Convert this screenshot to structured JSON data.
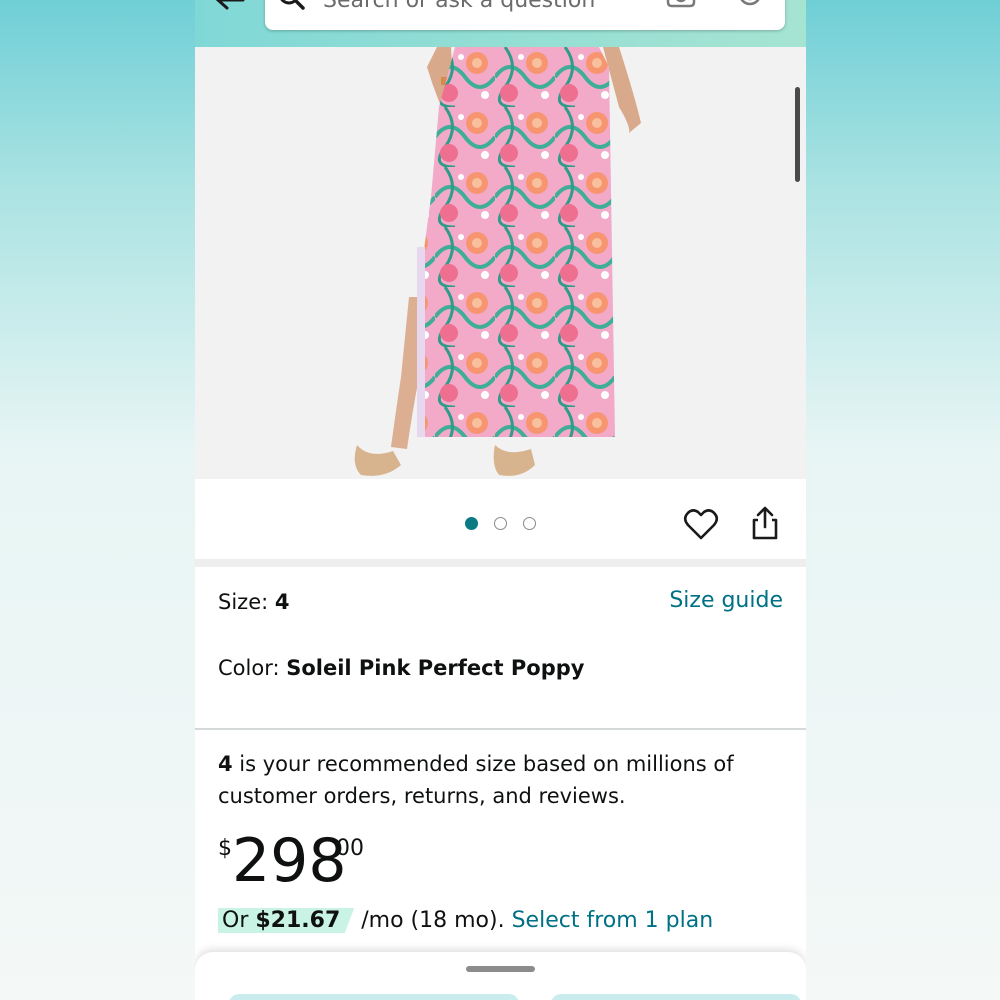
{
  "header": {
    "search_placeholder": "Search or ask a question",
    "icons": [
      "back-arrow-icon",
      "search-icon",
      "camera-icon",
      "mic-icon"
    ]
  },
  "gallery": {
    "dots": [
      {
        "active": true
      },
      {
        "active": false
      },
      {
        "active": false
      }
    ],
    "actions": [
      "heart-icon",
      "share-icon"
    ]
  },
  "variation": {
    "size_label": "Size: ",
    "size_value": "4",
    "size_guide": "Size guide",
    "color_label": "Color: ",
    "color_value": "Soleil Pink Perfect Poppy"
  },
  "recommendation": {
    "size": "4",
    "text": " is your recommended size based on millions of customer orders, returns, and reviews."
  },
  "price": {
    "symbol": "$",
    "whole": "298",
    "fraction": "00"
  },
  "installment": {
    "prefix": "Or ",
    "amount": "$21.67",
    "term": " /mo (18 mo). ",
    "link": "Select from 1 plan"
  },
  "colors": {
    "accent": "#007185",
    "dot_active": "#0a7b83",
    "installment_badge": "#c9f3e5"
  }
}
